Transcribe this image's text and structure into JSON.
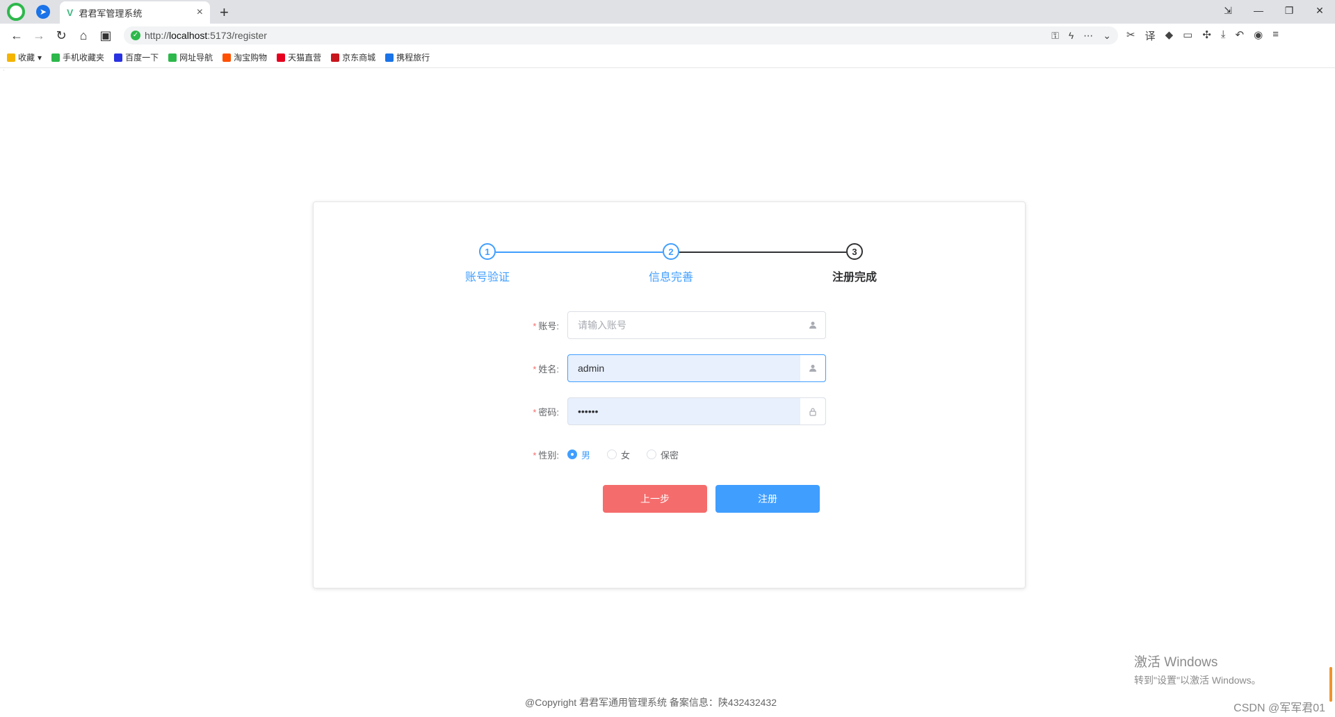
{
  "browser": {
    "tab_title": "君君军管理系统",
    "url_prefix": "http://",
    "url_host": "localhost",
    "url_rest": ":5173/register",
    "new_tab": "+",
    "close_tab": "×",
    "window_controls": [
      "⇲",
      "—",
      "❐",
      "✕"
    ]
  },
  "bookmarks": [
    {
      "label": "收藏",
      "icon": "star-icon",
      "color": "#f4b400"
    },
    {
      "label": "手机收藏夹",
      "icon": "phone-icon",
      "color": "#2db84b"
    },
    {
      "label": "百度一下",
      "icon": "baidu-icon",
      "color": "#2932e1"
    },
    {
      "label": "网址导航",
      "icon": "nav-icon",
      "color": "#2db84b"
    },
    {
      "label": "淘宝购物",
      "icon": "taobao-icon",
      "color": "#ff5000"
    },
    {
      "label": "天猫直营",
      "icon": "tmall-icon",
      "color": "#e6001e"
    },
    {
      "label": "京东商城",
      "icon": "jd-icon",
      "color": "#c8161d"
    },
    {
      "label": "携程旅行",
      "icon": "ctrip-icon",
      "color": "#1a73e8"
    }
  ],
  "steps": [
    {
      "num": "1",
      "label": "账号验证",
      "state": "done"
    },
    {
      "num": "2",
      "label": "信息完善",
      "state": "done"
    },
    {
      "num": "3",
      "label": "注册完成",
      "state": "active"
    }
  ],
  "form": {
    "account": {
      "label": "账号:",
      "placeholder": "请输入账号",
      "value": ""
    },
    "name": {
      "label": "姓名:",
      "value": "admin"
    },
    "password": {
      "label": "密码:",
      "value": "••••••"
    },
    "gender": {
      "label": "性别:",
      "options": [
        "男",
        "女",
        "保密"
      ],
      "selected": "男"
    }
  },
  "buttons": {
    "prev": "上一步",
    "register": "注册"
  },
  "footer": "@Copyright 君君军通用管理系统 备案信息：陕432432432",
  "watermark": {
    "line1": "激活 Windows",
    "line2": "转到\"设置\"以激活 Windows。"
  },
  "csdn": "CSDN @军军君01"
}
